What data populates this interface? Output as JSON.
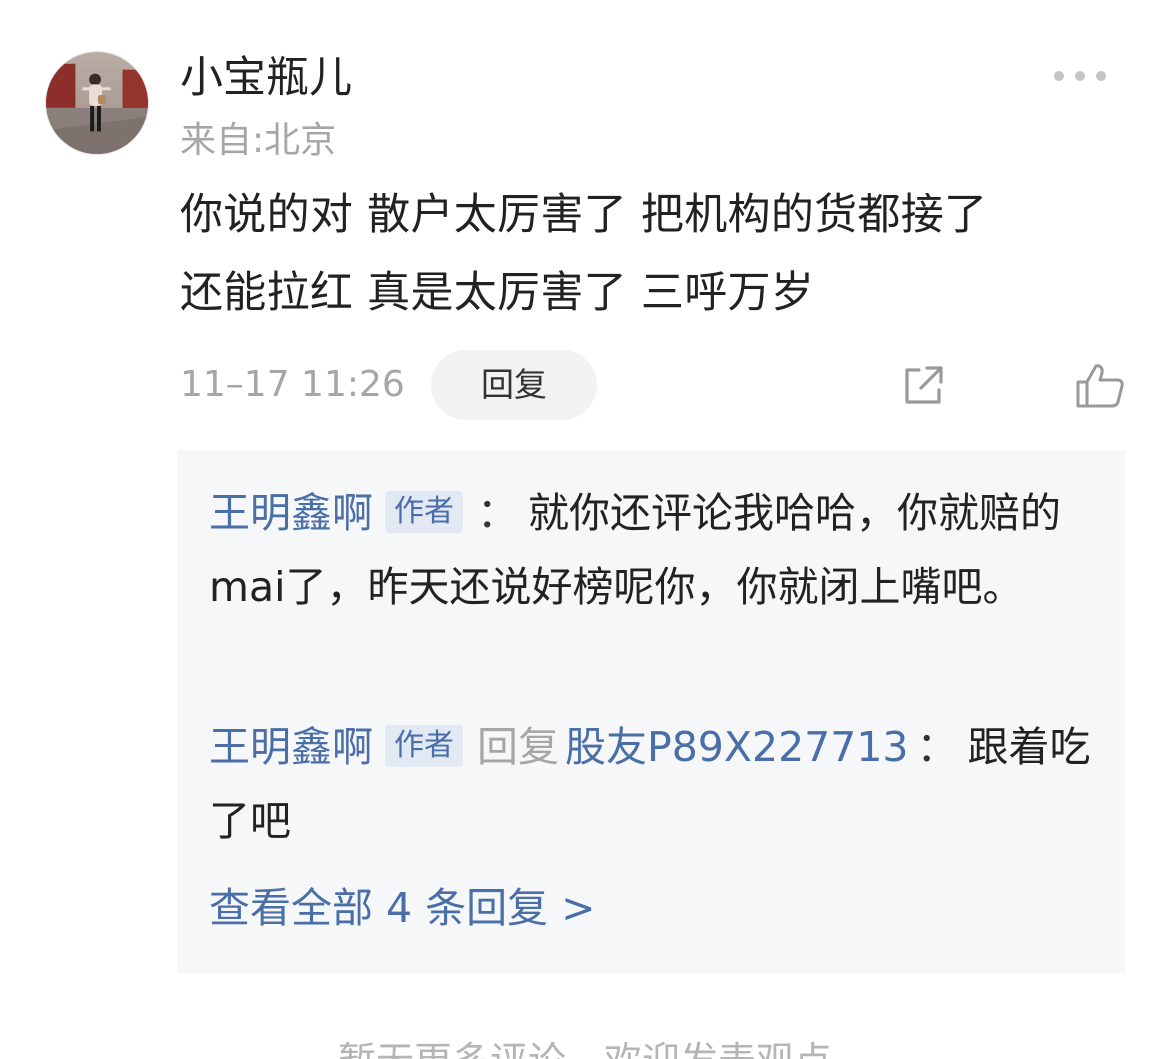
{
  "comment": {
    "username": "小宝瓶儿",
    "location": "来自:北京",
    "more_icon": "more-dots-icon",
    "body_line1": "你说的对 散户太厉害了 把机构的货都接了",
    "body_line2": "还能拉红 真是太厉害了 三呼万岁",
    "timestamp": "11–17 11:26",
    "reply_label": "回复",
    "share_icon": "share-icon",
    "like_icon": "thumbs-up-icon"
  },
  "replies": {
    "items": [
      {
        "author": "王明鑫啊",
        "tag": "作者",
        "colon": "：",
        "text": "就你还评论我哈哈，你就赔的mai了，昨天还说好榜呢你，你就闭上嘴吧。"
      },
      {
        "author": "王明鑫啊",
        "tag": "作者",
        "reply_word": "回复",
        "target": "股友P89X227713",
        "colon": "：",
        "text": "跟着吃了吧"
      }
    ],
    "view_all": "查看全部 4 条回复 >"
  },
  "footer": {
    "hint": "暂无更多评论，欢迎发表观点"
  },
  "colors": {
    "link": "#4a6ea8",
    "muted": "#a6a6a6",
    "reply_box_bg": "#f6f7f9"
  }
}
